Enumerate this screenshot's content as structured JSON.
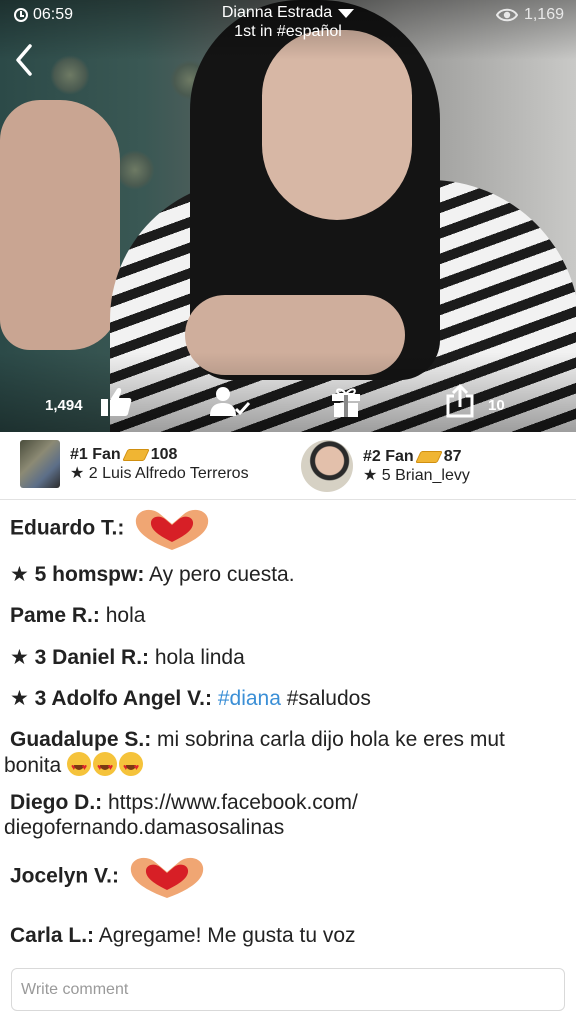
{
  "status": {
    "time": "06:59",
    "viewers": "1,169"
  },
  "broadcast": {
    "host": "Dianna Estrada",
    "rank": "1st in #español"
  },
  "controls": {
    "likes": "1,494",
    "shares": "10"
  },
  "fans": [
    {
      "rank": "#1 Fan",
      "points": "108",
      "name": "★ 2 Luis Alfredo Terreros"
    },
    {
      "rank": "#2 Fan",
      "points": "87",
      "name": "★ 5 Brian_levy"
    }
  ],
  "chat": [
    {
      "author": "Eduardo T.:",
      "text": "",
      "emoji": "heart-hands"
    },
    {
      "author": "★ 5 homspw:",
      "text": " Ay pero cuesta."
    },
    {
      "author": "Pame R.:",
      "text": " hola"
    },
    {
      "author": "★ 3 Daniel R.:",
      "text": " hola linda"
    },
    {
      "author": "★ 3 Adolfo Angel V.:",
      "tag": " #diana",
      "text": " #saludos"
    },
    {
      "author": "Guadalupe S.:",
      "text": " mi sobrina carla dijo hola ke eres mut bonita"
    },
    {
      "author": "Diego D.:",
      "text": " https://www.facebook.com/ diegofernando.damasosalinas"
    },
    {
      "author": "Jocelyn V.:",
      "text": "",
      "emoji": "heart-hands"
    },
    {
      "author": "Carla L.:",
      "text": " Agregame! Me gusta tu voz"
    }
  ],
  "comment": {
    "placeholder": "Write comment"
  },
  "colors": {
    "hashtag": "#3b8fd6",
    "coin": "#f0b533"
  }
}
